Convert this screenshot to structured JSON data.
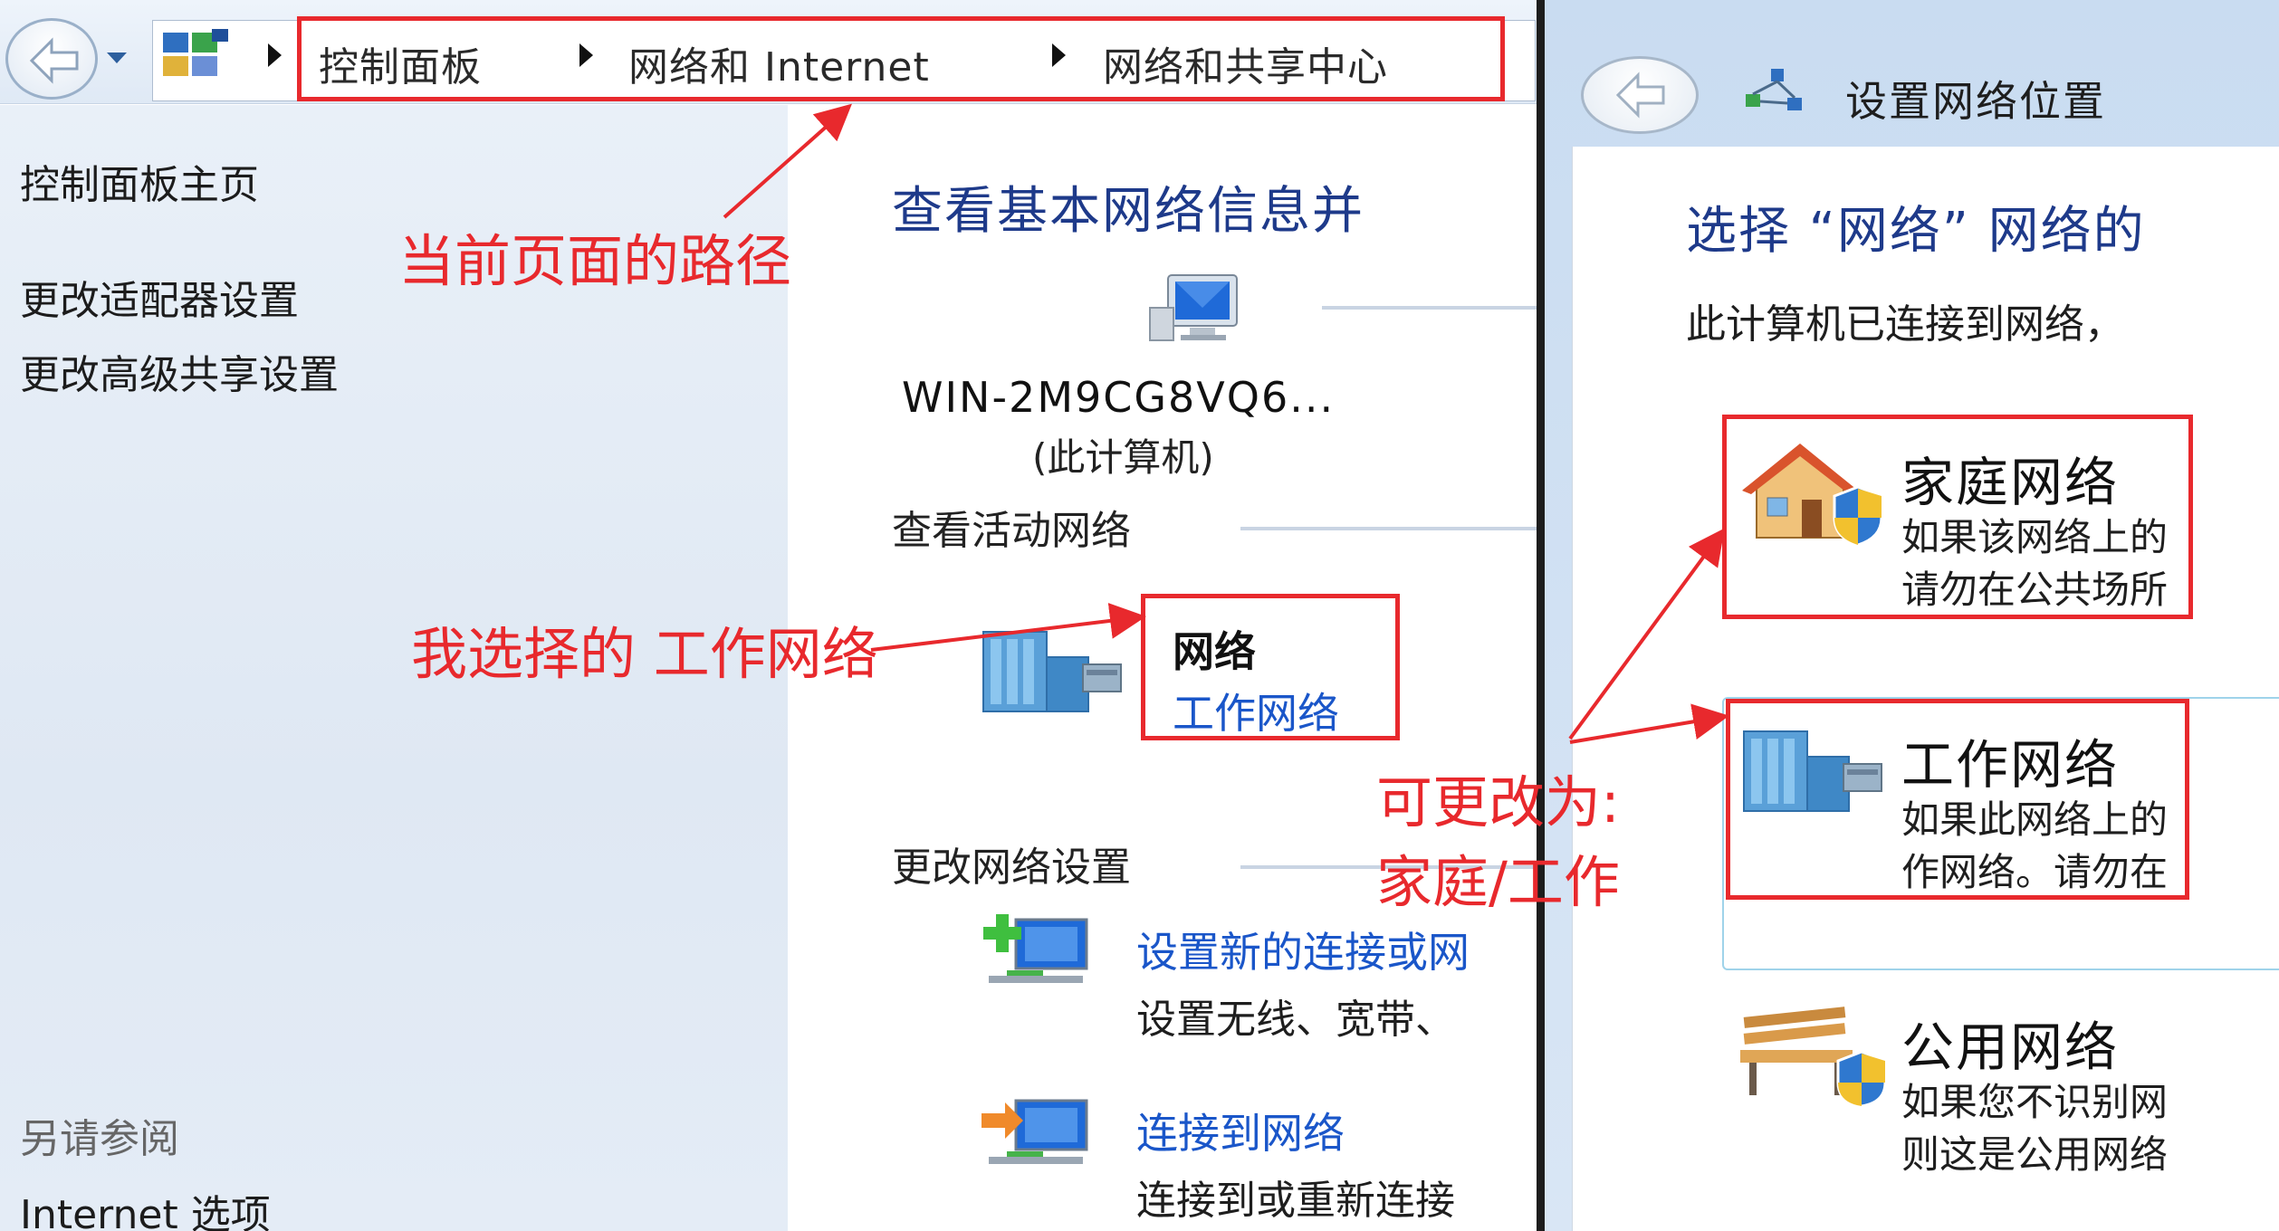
{
  "left_window": {
    "breadcrumb": [
      "控制面板",
      "网络和 Internet",
      "网络和共享中心"
    ],
    "sidebar": {
      "links": [
        "控制面板主页",
        "更改适配器设置",
        "更改高级共享设置"
      ],
      "see_also_heading": "另请参阅",
      "see_also_links": [
        "Internet 选项"
      ]
    },
    "main": {
      "title": "查看基本网络信息并",
      "computer_name": "WIN-2M9CG8VQ6...",
      "computer_label": "(此计算机)",
      "active_networks_heading": "查看活动网络",
      "network_name": "网络",
      "network_type": "工作网络",
      "change_settings_heading": "更改网络设置",
      "tasks": [
        {
          "link": "设置新的连接或网",
          "desc": "设置无线、宽带、"
        },
        {
          "link": "连接到网络",
          "desc": "连接到或重新连接"
        }
      ]
    }
  },
  "right_window": {
    "title": "设置网络位置",
    "heading": "选择 “网络” 网络的",
    "description": "此计算机已连接到网络，",
    "options": [
      {
        "title": "家庭网络",
        "line1": "如果该网络上的",
        "line2": "请勿在公共场所"
      },
      {
        "title": "工作网络",
        "line1": "如果此网络上的",
        "line2": "作网络。请勿在"
      },
      {
        "title": "公用网络",
        "line1": "如果您不识别网",
        "line2": "则这是公用网络"
      }
    ]
  },
  "annotations": {
    "path_note": "当前页面的路径",
    "selected_note": "我选择的 工作网络",
    "change_note_line1": "可更改为:",
    "change_note_line2": "家庭/工作",
    "color": "#e8292d"
  }
}
